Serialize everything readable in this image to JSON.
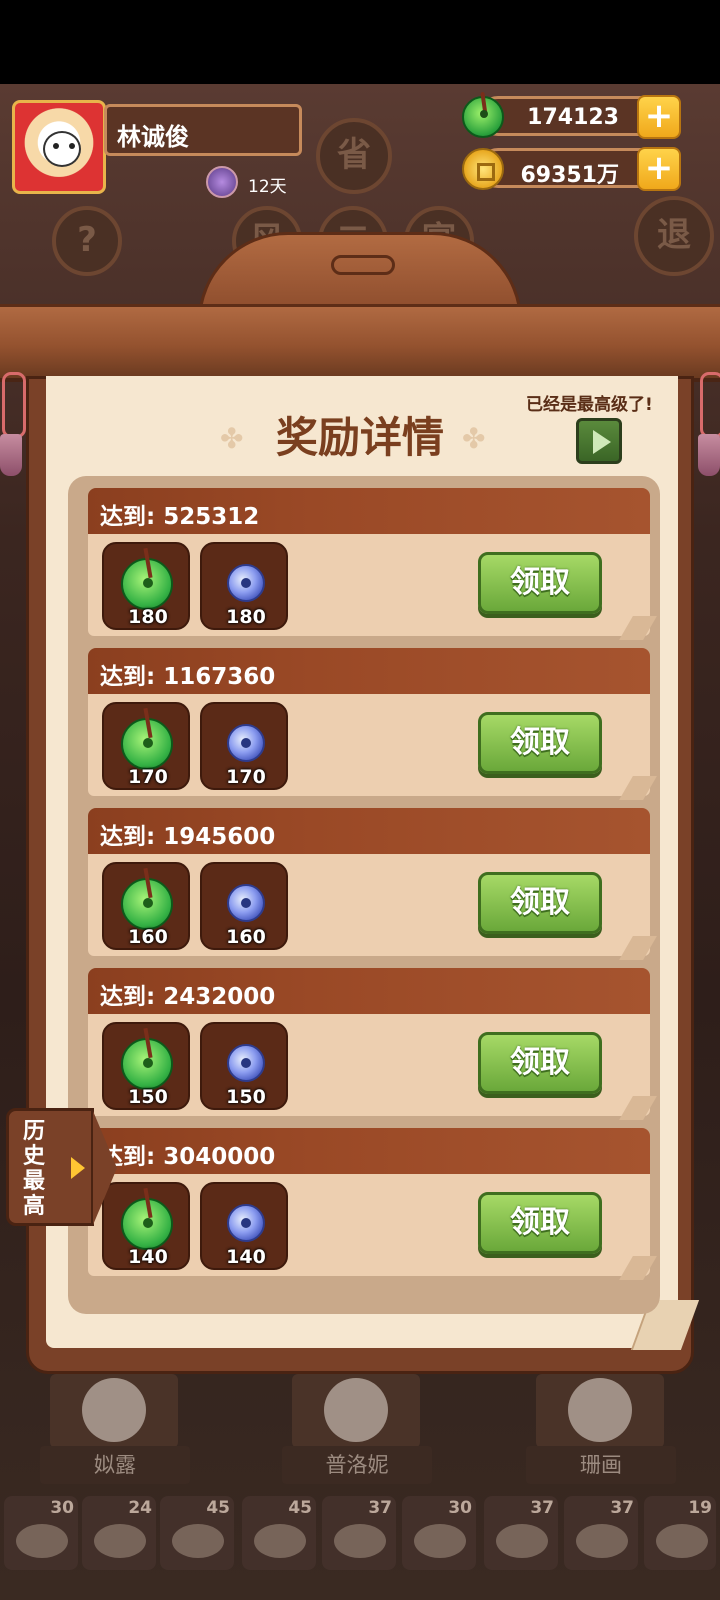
{
  "header": {
    "player_name": "林诚俊",
    "days": "12天",
    "jade_amount": "174123",
    "coin_amount": "69351万",
    "plus_label": "+",
    "bg_buttons": [
      "省",
      "?",
      "风",
      "二",
      "宴",
      "退"
    ]
  },
  "panel": {
    "title": "奖励详情",
    "max_level_note": "已经是最高级了!",
    "claim_label": "领取",
    "history_tab": "历史最高",
    "rows": [
      {
        "target": "达到: 525312",
        "jade": "180",
        "disc": "180"
      },
      {
        "target": "达到: 1167360",
        "jade": "170",
        "disc": "170"
      },
      {
        "target": "达到: 1945600",
        "jade": "160",
        "disc": "160"
      },
      {
        "target": "达到: 2432000",
        "jade": "150",
        "disc": "150"
      },
      {
        "target": "达到: 3040000",
        "jade": "140",
        "disc": "140"
      }
    ]
  },
  "bottom": {
    "characters": [
      "姒露",
      "普洛妮",
      "珊画"
    ],
    "food_counts": [
      "30",
      "24",
      "45",
      "45",
      "37",
      "30",
      "37",
      "37",
      "19"
    ]
  },
  "colors": {
    "claim_green": "#8cc450",
    "panel_bg": "#f6e7d0",
    "row_header": "#9a4926",
    "title_brown": "#7a3f1f"
  },
  "icons": {
    "jade": "jade-pendant-icon",
    "coin": "copper-coin-icon",
    "disc": "blue-jade-disc-icon",
    "play": "play-icon"
  }
}
